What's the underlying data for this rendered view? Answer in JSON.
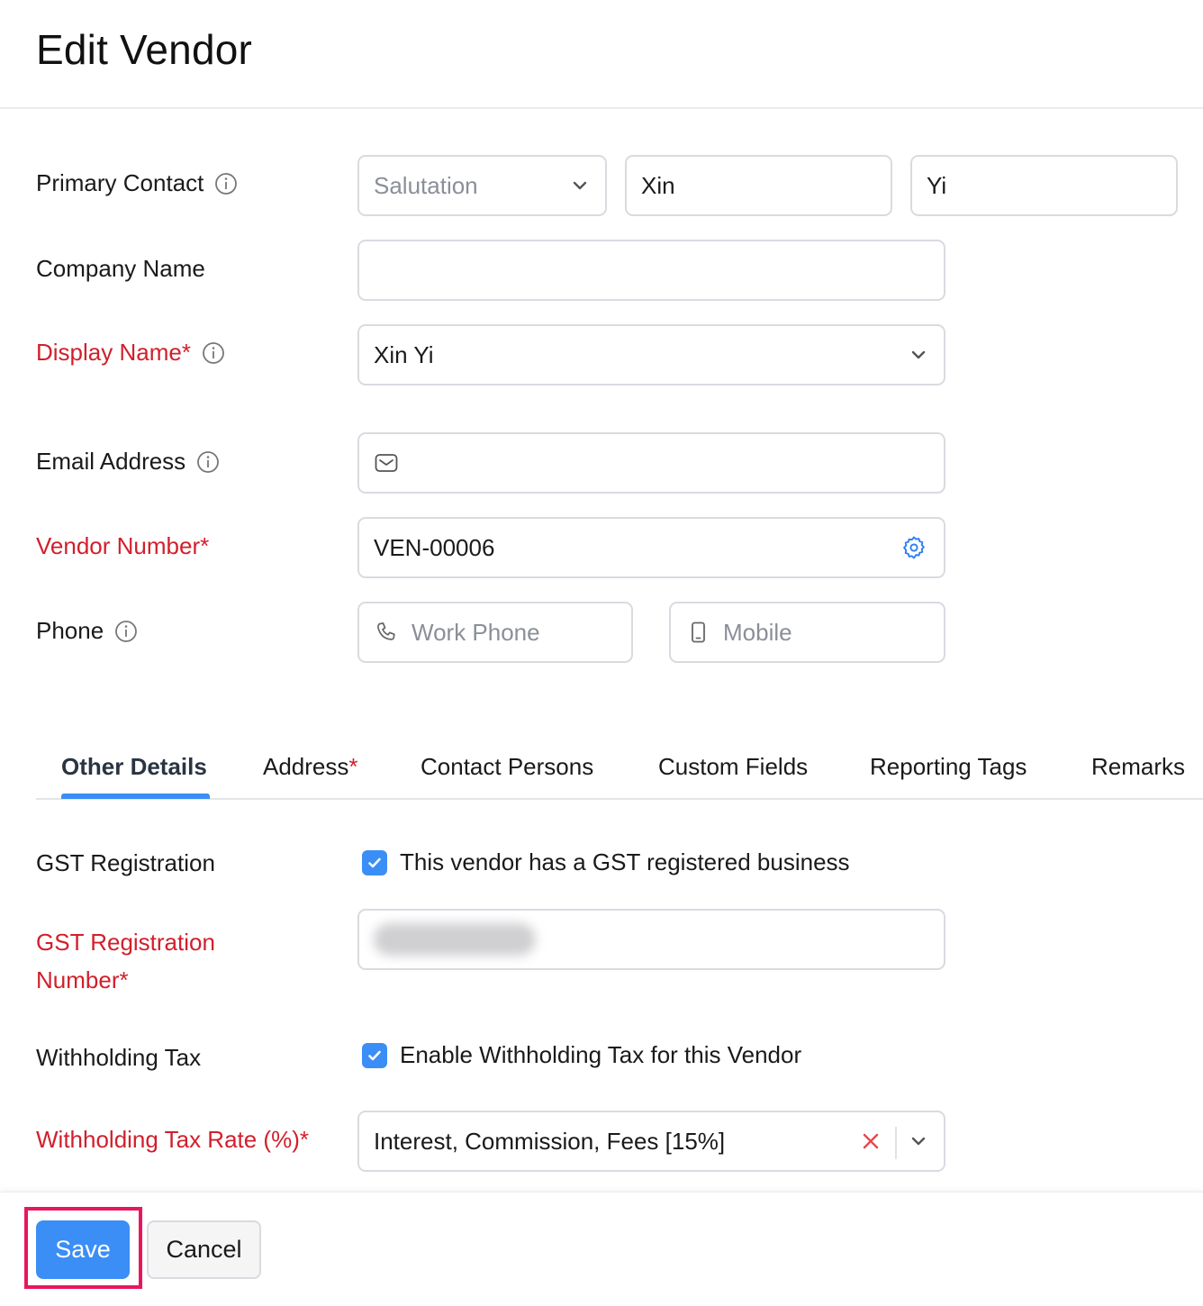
{
  "page": {
    "title": "Edit Vendor"
  },
  "primary_contact": {
    "label": "Primary Contact",
    "salutation_placeholder": "Salutation",
    "first_name": "Xin",
    "last_name": "Yi"
  },
  "company_name": {
    "label": "Company Name",
    "value": ""
  },
  "display_name": {
    "label": "Display Name*",
    "value": "Xin Yi"
  },
  "email": {
    "label": "Email Address",
    "value": ""
  },
  "vendor_number": {
    "label": "Vendor Number*",
    "value": "VEN-00006"
  },
  "phone": {
    "label": "Phone",
    "work_placeholder": "Work Phone",
    "mobile_placeholder": "Mobile"
  },
  "tabs": [
    {
      "label": "Other Details",
      "active": true
    },
    {
      "label": "Address",
      "required_mark": "*"
    },
    {
      "label": "Contact Persons"
    },
    {
      "label": "Custom Fields"
    },
    {
      "label": "Reporting Tags"
    },
    {
      "label": "Remarks"
    }
  ],
  "gst_registration": {
    "label": "GST Registration",
    "checkbox_label": "This vendor has a GST registered business",
    "checked": true
  },
  "gst_number": {
    "label_line1": "GST Registration",
    "label_line2": "Number*"
  },
  "withholding_tax": {
    "label": "Withholding Tax",
    "checkbox_label": "Enable Withholding Tax for this Vendor",
    "checked": true
  },
  "withholding_rate": {
    "label": "Withholding Tax Rate (%)*",
    "value": "Interest, Commission, Fees [15%]"
  },
  "footer": {
    "save_label": "Save",
    "cancel_label": "Cancel"
  },
  "colors": {
    "accent": "#3a8ef6",
    "required": "#d21f2b",
    "highlight": "#e8175d",
    "clear": "#e5484d"
  }
}
